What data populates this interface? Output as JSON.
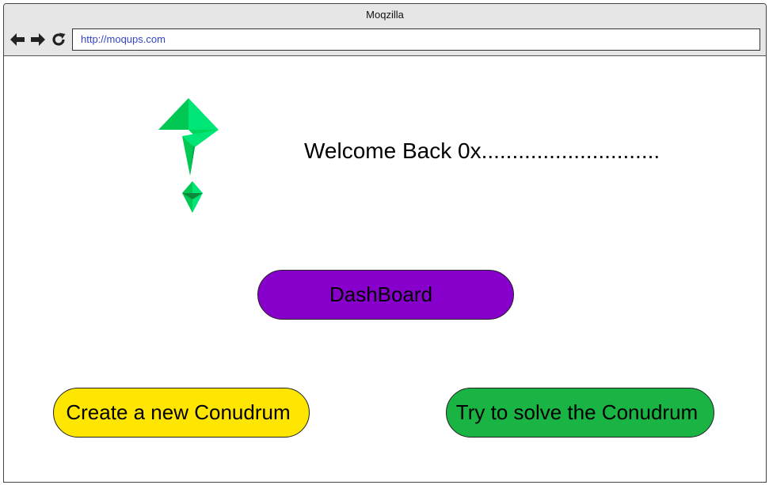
{
  "browser": {
    "title": "Moqzilla",
    "url": "http://moqups.com"
  },
  "icons": {
    "back": "arrow-left-icon",
    "forward": "arrow-right-icon",
    "reload": "reload-icon",
    "logo": "green-question-mark-logo"
  },
  "main": {
    "welcome_text": "Welcome Back 0x.............................",
    "dashboard_label": "DashBoard",
    "create_label": "Create a new Conudrum",
    "solve_label": "Try to solve the Conudrum"
  },
  "colors": {
    "dashboard": "#8800cc",
    "create": "#ffe600",
    "solve": "#1ab444",
    "logo_green": "#00d65a"
  }
}
